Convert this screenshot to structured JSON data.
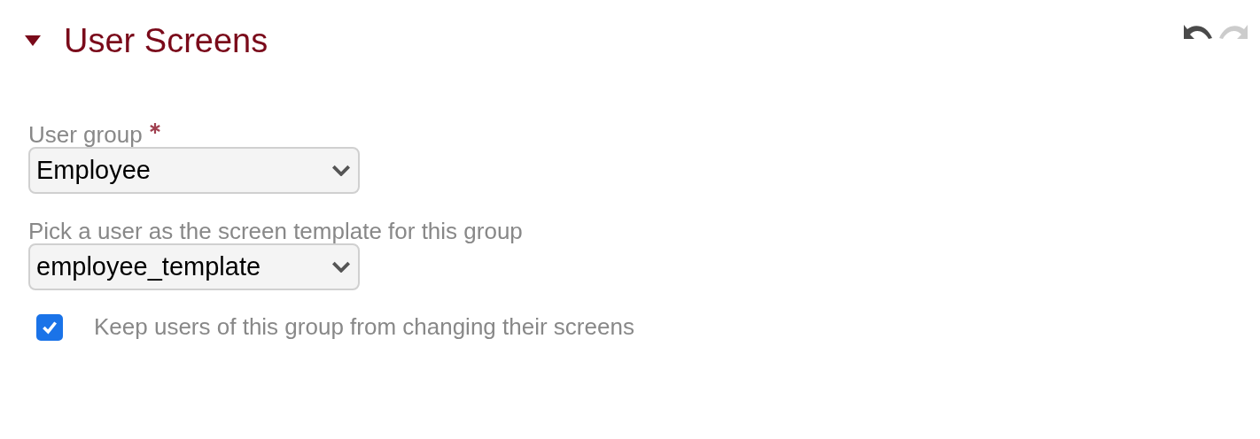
{
  "section": {
    "title": "User Screens",
    "expanded": true
  },
  "toolbar": [
    {
      "kind": "undo",
      "disabled": false
    },
    {
      "kind": "redo",
      "disabled": true
    }
  ],
  "fields": [
    {
      "label": "User group",
      "required": true,
      "value": "Employee"
    },
    {
      "label": "Pick a user as the screen template for this group",
      "required": false,
      "value": "employee_template"
    }
  ],
  "checkbox": {
    "label": "Keep users of this group from changing their screens",
    "checked": true
  }
}
